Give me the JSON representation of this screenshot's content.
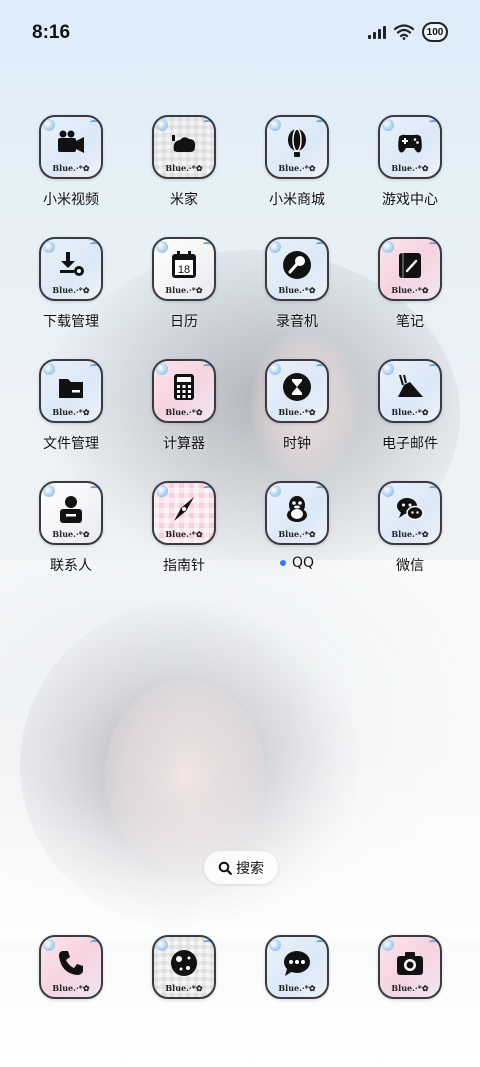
{
  "status_bar": {
    "time": "8:16",
    "battery": "100"
  },
  "apps": [
    {
      "label": "小米视频",
      "icon": "video-camera-icon",
      "brand": "Blue.·*✿"
    },
    {
      "label": "米家",
      "icon": "mijia-icon",
      "brand": "Blue.·*✿"
    },
    {
      "label": "小米商城",
      "icon": "balloon-icon",
      "brand": "Blue.·*✿"
    },
    {
      "label": "游戏中心",
      "icon": "gamepad-icon",
      "brand": "Blue.·*✿"
    },
    {
      "label": "下载管理",
      "icon": "download-gear-icon",
      "brand": "Blue.·*✿"
    },
    {
      "label": "日历",
      "icon": "calendar-icon",
      "brand": "Blue.·*✿",
      "day": "18"
    },
    {
      "label": "录音机",
      "icon": "microphone-icon",
      "brand": "Blue.·*✿"
    },
    {
      "label": "笔记",
      "icon": "notebook-icon",
      "brand": "Blue.·*✿"
    },
    {
      "label": "文件管理",
      "icon": "folder-icon",
      "brand": "Blue.·*✿"
    },
    {
      "label": "计算器",
      "icon": "calculator-icon",
      "brand": "Blue.·*✿"
    },
    {
      "label": "时钟",
      "icon": "hourglass-icon",
      "brand": "Blue.·*✿"
    },
    {
      "label": "电子邮件",
      "icon": "paper-plane-icon",
      "brand": "Blue.·*✿"
    },
    {
      "label": "联系人",
      "icon": "contact-card-icon",
      "brand": "Blue.·*✿"
    },
    {
      "label": "指南针",
      "icon": "compass-icon",
      "brand": "Blue.·*✿"
    },
    {
      "label": "QQ",
      "icon": "penguin-icon",
      "brand": "Blue.·*✿",
      "new_dot": true
    },
    {
      "label": "微信",
      "icon": "wechat-icon",
      "brand": "Blue.·*✿"
    }
  ],
  "search": {
    "label": "搜索"
  },
  "dock": [
    {
      "icon": "phone-icon",
      "brand": "Blue.·*✿"
    },
    {
      "icon": "browser-globe-icon",
      "brand": "Blue.·*✿"
    },
    {
      "icon": "messages-icon",
      "brand": "Blue.·*✿"
    },
    {
      "icon": "camera-icon",
      "brand": "Blue.·*✿"
    }
  ]
}
